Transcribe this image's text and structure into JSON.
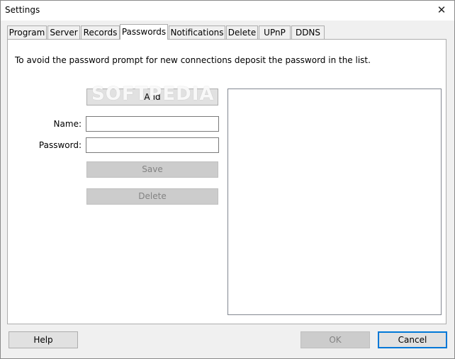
{
  "window": {
    "title": "Settings",
    "close_glyph": "✕"
  },
  "tabs": [
    {
      "label": "Program"
    },
    {
      "label": "Server"
    },
    {
      "label": "Records"
    },
    {
      "label": "Passwords",
      "active": true
    },
    {
      "label": "Notifications"
    },
    {
      "label": "Delete"
    },
    {
      "label": "UPnP"
    },
    {
      "label": "DDNS"
    }
  ],
  "passwords": {
    "info_text": "To avoid the password prompt for new connections deposit the password in the list.",
    "add_label": "Add",
    "name_label": "Name:",
    "name_value": "",
    "password_label": "Password:",
    "password_value": "",
    "save_label": "Save",
    "delete_label": "Delete",
    "list_items": []
  },
  "footer": {
    "help_label": "Help",
    "ok_label": "OK",
    "cancel_label": "Cancel"
  },
  "watermark": "SOFTPEDIA",
  "colors": {
    "accent": "#0078d7",
    "disabled_bg": "#cccccc",
    "disabled_text": "#838383"
  },
  "icons": {
    "close": "close-icon"
  }
}
